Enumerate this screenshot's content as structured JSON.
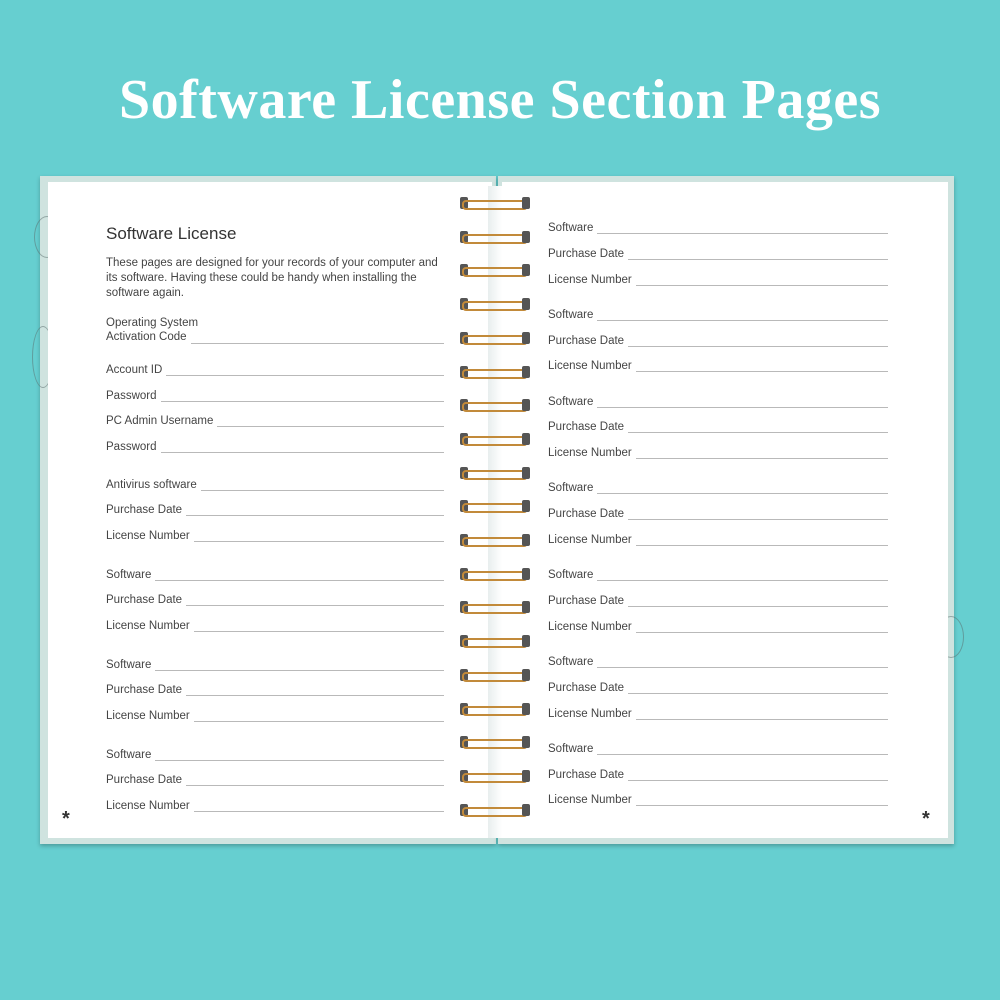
{
  "headline": "Software License Section Pages",
  "left_page": {
    "title": "Software License",
    "intro": "These pages are designed for your records of your computer and its software. Having these could be handy when installing the software again.",
    "os_label_line1": "Operating System",
    "os_label_line2": "Activation Code",
    "fields": [
      "Account ID",
      "Password",
      "PC Admin Username",
      "Password",
      "Antivirus software",
      "Purchase Date",
      "License Number",
      "Software",
      "Purchase Date",
      "License Number",
      "Software",
      "Purchase Date",
      "License Number",
      "Software",
      "Purchase Date",
      "License Number"
    ],
    "footer_mark": "*"
  },
  "right_page": {
    "fields": [
      "Software",
      "Purchase Date",
      "License Number",
      "Software",
      "Purchase Date",
      "License Number",
      "Software",
      "Purchase Date",
      "License Number",
      "Software",
      "Purchase Date",
      "License Number",
      "Software",
      "Purchase Date",
      "License Number",
      "Software",
      "Purchase Date",
      "License Number",
      "Software",
      "Purchase Date",
      "License Number"
    ],
    "footer_mark": "*"
  },
  "colors": {
    "background": "#66cfd0",
    "headline": "#ffffff",
    "spiral": "#c28a3a"
  }
}
